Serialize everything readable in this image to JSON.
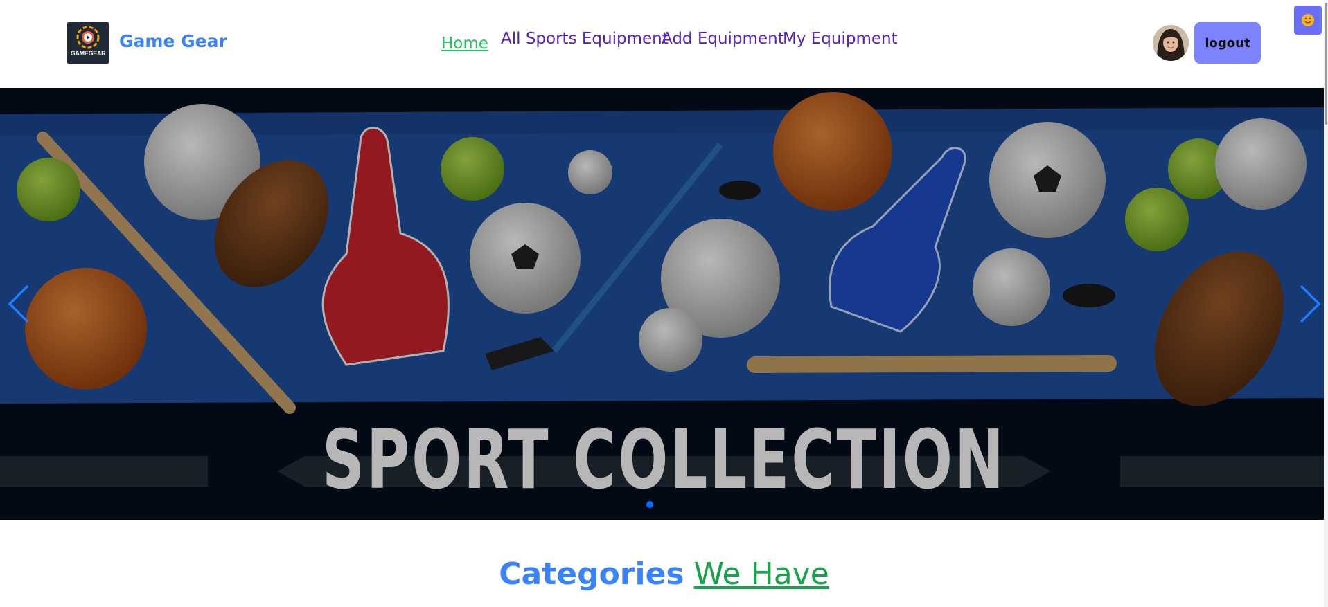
{
  "header": {
    "logo_text": "GAMEGEAR",
    "brand": "Game Gear",
    "nav": [
      {
        "label": "Home",
        "active": true
      },
      {
        "label": "All Sports Equipment"
      },
      {
        "label": "Add Equipment"
      },
      {
        "label": "My Equipment"
      }
    ],
    "logout_label": "logout",
    "theme_icon": "sun-icon"
  },
  "carousel": {
    "banner_text": "SPORT COLLECTION",
    "prev_icon": "chevron-left-icon",
    "next_icon": "chevron-right-icon",
    "active_slide": 1,
    "slide_count": 1
  },
  "categories": {
    "title_part1": "Categories",
    "title_part2": "We Have"
  },
  "colors": {
    "brand": "#3b82f6",
    "nav_link": "#5b21b6",
    "nav_active": "#22c55e",
    "button": "#7c83fd",
    "accent_green": "#16a34a"
  }
}
